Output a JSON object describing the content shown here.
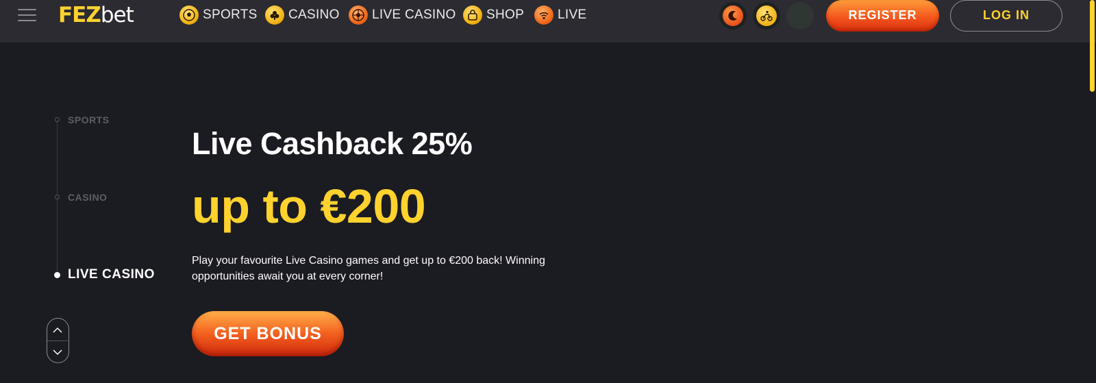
{
  "brand": {
    "logo_part1": "FEZ",
    "logo_part2": "bet",
    "accent_color": "#ffd22e",
    "cta_color": "#f4561d"
  },
  "header": {
    "nav": [
      {
        "label": "SPORTS",
        "icon": "soccer-ball-icon"
      },
      {
        "label": "CASINO",
        "icon": "club-suit-icon"
      },
      {
        "label": "LIVE CASINO",
        "icon": "roulette-icon"
      },
      {
        "label": "SHOP",
        "icon": "shopping-bag-icon"
      },
      {
        "label": "LIVE",
        "icon": "live-signal-icon"
      }
    ],
    "quick_icons": [
      "crescent-promo-icon",
      "cyclist-icon",
      "dark-circle-icon"
    ],
    "register_label": "REGISTER",
    "login_label": "LOG IN"
  },
  "side_nav": {
    "items": [
      {
        "label": "SPORTS",
        "active": false
      },
      {
        "label": "CASINO",
        "active": false
      },
      {
        "label": "LIVE CASINO",
        "active": true
      }
    ]
  },
  "hero": {
    "title": "Live Cashback 25%",
    "amount": "up to €200",
    "description": "Play your favourite Live Casino games and get up to €200 back! Winning opportunities await you at every corner!",
    "cta_label": "GET BONUS"
  }
}
